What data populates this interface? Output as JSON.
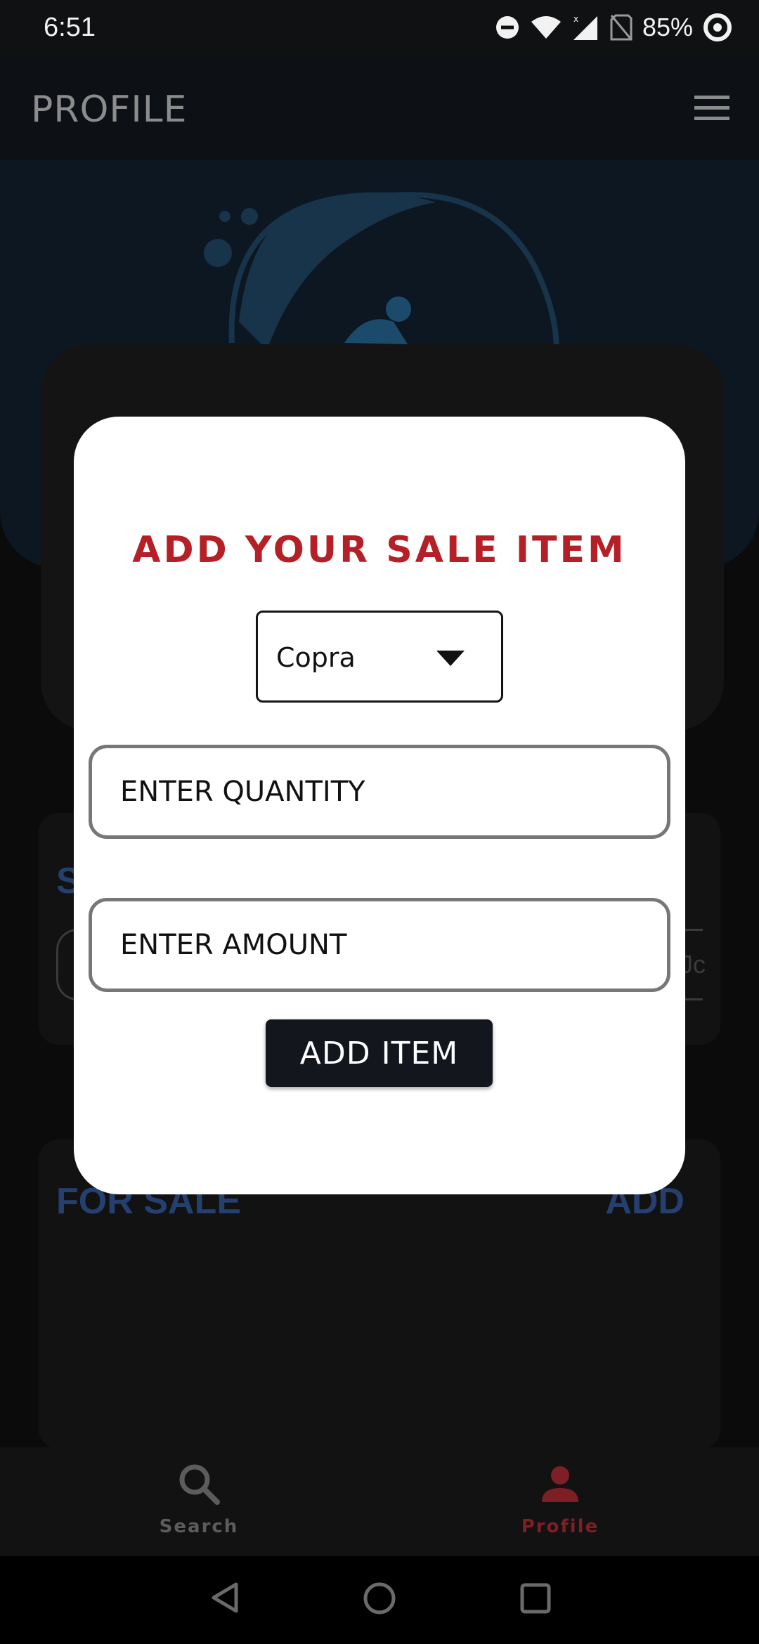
{
  "status_bar": {
    "time": "6:51",
    "battery": "85%",
    "icons": [
      "dnd-icon",
      "wifi-icon",
      "signal-icon",
      "no-sim-icon",
      "battery-icon"
    ]
  },
  "app_bar": {
    "title": "PROFILE",
    "menu_icon": "hamburger-menu-icon"
  },
  "background": {
    "card_s_letter": "S",
    "field_partial_text": "Jc",
    "for_sale_title": "FOR SALE",
    "for_sale_add": "ADD"
  },
  "modal": {
    "title": "ADD YOUR SALE ITEM",
    "dropdown": {
      "selected": "Copra"
    },
    "quantity_field": {
      "placeholder": "ENTER QUANTITY",
      "value": ""
    },
    "amount_field": {
      "placeholder": "ENTER AMOUNT",
      "value": ""
    },
    "submit_label": "ADD ITEM"
  },
  "bottom_nav": {
    "items": [
      {
        "label": "Search",
        "icon": "search-icon",
        "active": false
      },
      {
        "label": "Profile",
        "icon": "person-icon",
        "active": true
      }
    ]
  },
  "colors": {
    "accent_red": "#b51f26",
    "nav_active": "#7d1f25",
    "dark_button": "#13161d",
    "faded_blue": "#25406e"
  }
}
